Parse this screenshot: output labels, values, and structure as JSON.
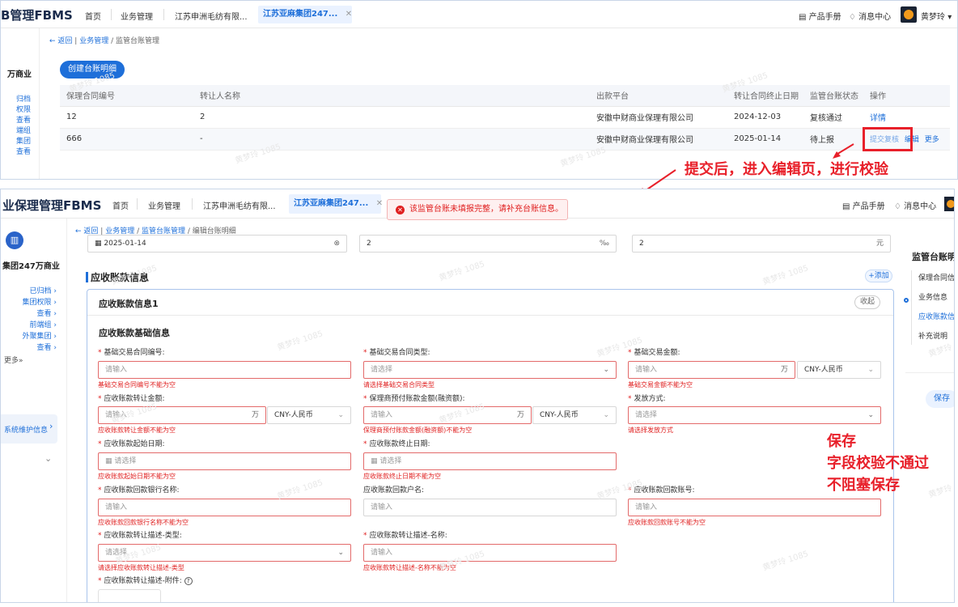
{
  "top_panel": {
    "logo": "B管理FBMS",
    "nav": {
      "home": "首页",
      "business": "业务管理"
    },
    "tabs": [
      "江苏申洲毛纺有限...",
      "江苏亚麻集团247..."
    ],
    "header_right": {
      "manual": "产品手册",
      "messages": "消息中心",
      "user": "黄梦玲"
    },
    "breadcrumb": {
      "back": "返回",
      "business": "业务管理",
      "current": "监管台账管理"
    },
    "left_col": {
      "title": "万商业",
      "items": [
        "归档",
        "权限",
        "查看",
        "端组",
        "集团",
        "查看"
      ]
    },
    "create_button": "创建台账明细",
    "table": {
      "headers": [
        "保理合同编号",
        "转让人名称",
        "出款平台",
        "转让合同终止日期",
        "监管台账状态",
        "操作"
      ],
      "rows": [
        {
          "contract_no": "12",
          "transferor": "2",
          "platform": "安徽中财商业保理有限公司",
          "end_date": "2024-12-03",
          "status": "复核通过",
          "actions": [
            "详情"
          ]
        },
        {
          "contract_no": "666",
          "transferor": "-",
          "platform": "安徽中财商业保理有限公司",
          "end_date": "2025-01-14",
          "status": "待上报",
          "actions": [
            "提交复核",
            "编辑",
            "更多"
          ]
        }
      ]
    }
  },
  "annotations": {
    "arrow_note": "提交后，进入编辑页，进行校验",
    "save_note": [
      "保存",
      "字段校验不通过",
      "不阻塞保存"
    ]
  },
  "watermark": "黄梦玲 1085",
  "bottom_panel": {
    "logo": "业保理管理FBMS",
    "nav": {
      "home": "首页",
      "business": "业务管理"
    },
    "tabs": [
      "江苏申洲毛纺有限...",
      "江苏亚麻集团247..."
    ],
    "toast": "该监管台账未填报完整，请补充台账信息。",
    "header_right": {
      "manual": "产品手册",
      "messages": "消息中心"
    },
    "breadcrumb": {
      "back": "返回",
      "business": "业务管理",
      "ledger": "监管台账管理",
      "current": "编辑台账明细"
    },
    "left_col": {
      "company": "集团247万商业",
      "items": [
        "已归档",
        "集团权限",
        "查看",
        "前端组",
        "外聚集团",
        "查看"
      ],
      "more": "更多",
      "active": "系统维护信息"
    },
    "prev_row": {
      "date": "2025-01-14",
      "value2": "2",
      "unit2": "‰",
      "value3": "2",
      "unit3": "元"
    },
    "section_title": "应收账款信息",
    "add_button": "+添加",
    "card_title": "应收账款信息1",
    "collapse_button": "收起",
    "sub_title": "应收账款基础信息",
    "fields": [
      {
        "label": "基础交易合同编号:",
        "placeholder": "请输入",
        "error": "基础交易合同编号不能为空",
        "required": true
      },
      {
        "label": "基础交易合同类型:",
        "placeholder": "请选择",
        "error": "请选择基础交易合同类型",
        "required": true
      },
      {
        "label": "基础交易金额:",
        "placeholder": "请输入",
        "unit": "万",
        "currency": "CNY-人民币",
        "error": "基础交易金额不能为空",
        "required": true
      },
      {
        "label": "应收账款转让金额:",
        "placeholder": "请输入",
        "unit": "万",
        "currency": "CNY-人民币",
        "error": "应收账款转让金额不能为空",
        "required": true
      },
      {
        "label": "保理商预付账款金额(融资额):",
        "placeholder": "请输入",
        "unit": "万",
        "currency": "CNY-人民币",
        "error": "保理商预付账款金额(融资额)不能为空",
        "required": true
      },
      {
        "label": "发放方式:",
        "placeholder": "请选择",
        "error": "请选择发放方式",
        "required": true
      },
      {
        "label": "应收账款起始日期:",
        "placeholder": "请选择",
        "error": "应收账款起始日期不能为空",
        "required": true
      },
      {
        "label": "应收账款终止日期:",
        "placeholder": "请选择",
        "error": "应收账款终止日期不能为空",
        "required": true
      },
      {
        "label": "应收账款回款银行名称:",
        "placeholder": "请输入",
        "error": "应收账款回款银行名称不能为空",
        "required": true
      },
      {
        "label": "应收账款回款户名:",
        "placeholder": "请输入",
        "error": "",
        "required": false
      },
      {
        "label": "应收账款回款账号:",
        "placeholder": "请输入",
        "error": "应收账款回款账号不能为空",
        "required": true
      },
      {
        "label": "应收账款转让描述-类型:",
        "placeholder": "请选择",
        "error": "请选择应收账款转让描述-类型",
        "required": true
      },
      {
        "label": "应收账款转让描述-名称:",
        "placeholder": "请输入",
        "error": "应收账款转让描述-名称不能为空",
        "required": true
      },
      {
        "label": "应收账款转让描述-附件:",
        "required": true
      }
    ],
    "right_nav": {
      "title": "监管台账明细",
      "items": [
        "保理合同信息",
        "业务信息",
        "应收账款信息",
        "补充说明"
      ],
      "save": "保存"
    }
  }
}
